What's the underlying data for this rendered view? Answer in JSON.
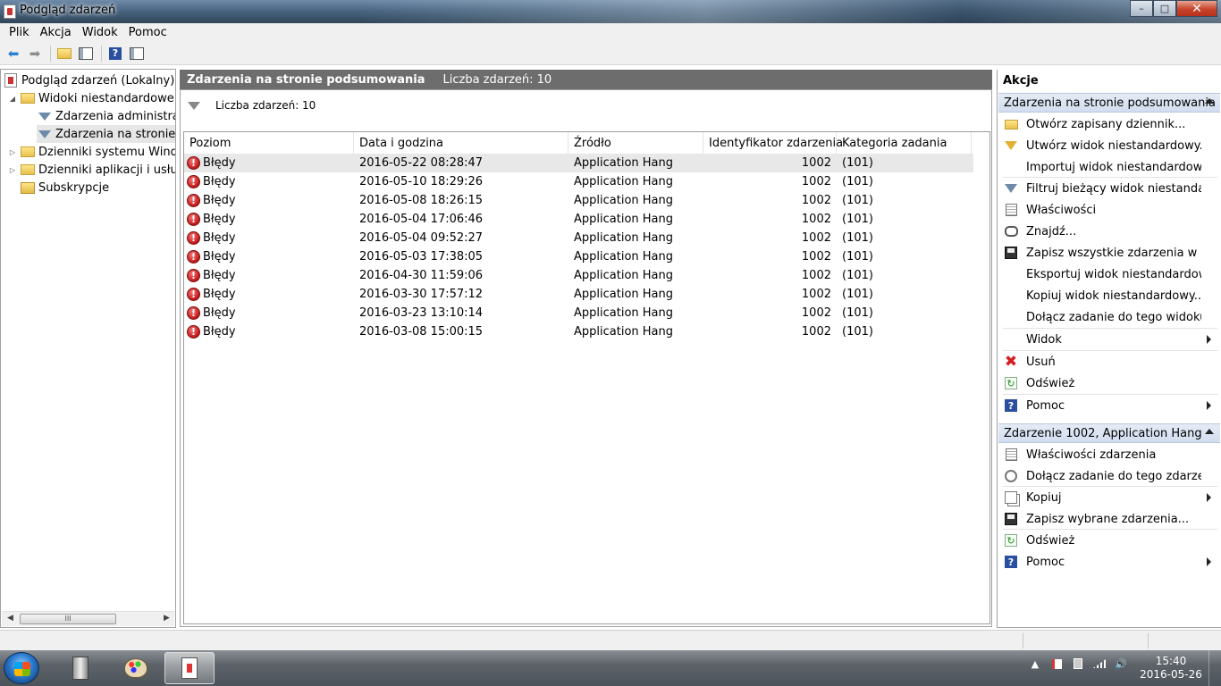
{
  "window": {
    "title": "Podgląd zdarzeń",
    "controls": {
      "minimize": "–",
      "maximize": "□",
      "close": "✕"
    }
  },
  "menu": [
    "Plik",
    "Akcja",
    "Widok",
    "Pomoc"
  ],
  "toolbar": {
    "icons": [
      "back-arrow-icon",
      "forward-arrow-icon",
      "up-folder-icon",
      "show-hide-tree-icon",
      "help-icon",
      "show-hide-action-pane-icon"
    ]
  },
  "tree": {
    "items": [
      {
        "label": "Podgląd zdarzeń (Lokalny)",
        "icon": "event-viewer-icon"
      },
      {
        "label": "Widoki niestandardowe",
        "icon": "folder-icon",
        "expander": "◢"
      },
      {
        "label": "Zdarzenia administracyjne",
        "icon": "filter-icon"
      },
      {
        "label": "Zdarzenia na stronie podsumowania",
        "icon": "filter-icon"
      },
      {
        "label": "Dzienniki systemu Windows",
        "icon": "folder-icon",
        "expander": "▷"
      },
      {
        "label": "Dzienniki aplikacji i usług",
        "icon": "folder-icon",
        "expander": "▷"
      },
      {
        "label": "Subskrypcje",
        "icon": "subscription-icon"
      }
    ],
    "scroll_left": "◀",
    "scroll_right": "▶",
    "scroll_grip": "III"
  },
  "main": {
    "header_title": "Zdarzenia na stronie podsumowania",
    "header_count": "Liczba zdarzeń: 10",
    "filter_text": "Liczba zdarzeń: 10",
    "columns": [
      "Poziom",
      "Data i godzina",
      "Źródło",
      "Identyfikator zdarzenia",
      "Kategoria zadania"
    ],
    "rows": [
      {
        "level": "Błędy",
        "datetime": "2016-05-22 08:28:47",
        "source": "Application Hang",
        "event_id": "1002",
        "category": "(101)"
      },
      {
        "level": "Błędy",
        "datetime": "2016-05-10 18:29:26",
        "source": "Application Hang",
        "event_id": "1002",
        "category": "(101)"
      },
      {
        "level": "Błędy",
        "datetime": "2016-05-08 18:26:15",
        "source": "Application Hang",
        "event_id": "1002",
        "category": "(101)"
      },
      {
        "level": "Błędy",
        "datetime": "2016-05-04 17:06:46",
        "source": "Application Hang",
        "event_id": "1002",
        "category": "(101)"
      },
      {
        "level": "Błędy",
        "datetime": "2016-05-04 09:52:27",
        "source": "Application Hang",
        "event_id": "1002",
        "category": "(101)"
      },
      {
        "level": "Błędy",
        "datetime": "2016-05-03 17:38:05",
        "source": "Application Hang",
        "event_id": "1002",
        "category": "(101)"
      },
      {
        "level": "Błędy",
        "datetime": "2016-04-30 11:59:06",
        "source": "Application Hang",
        "event_id": "1002",
        "category": "(101)"
      },
      {
        "level": "Błędy",
        "datetime": "2016-03-30 17:57:12",
        "source": "Application Hang",
        "event_id": "1002",
        "category": "(101)"
      },
      {
        "level": "Błędy",
        "datetime": "2016-03-23 13:10:14",
        "source": "Application Hang",
        "event_id": "1002",
        "category": "(101)"
      },
      {
        "level": "Błędy",
        "datetime": "2016-03-08 15:00:15",
        "source": "Application Hang",
        "event_id": "1002",
        "category": "(101)"
      }
    ],
    "error_glyph": "!"
  },
  "actions": {
    "title": "Akcje",
    "section1": {
      "title": "Zdarzenia na stronie podsumowania",
      "items": [
        {
          "label": "Otwórz zapisany dziennik...",
          "icon": "open-folder-icon"
        },
        {
          "label": "Utwórz widok niestandardowy...",
          "icon": "create-filter-icon"
        },
        {
          "label": "Importuj widok niestandardowy...",
          "icon": ""
        },
        {
          "label": "Filtruj bieżący widok niestandardowy...",
          "icon": "filter-icon"
        },
        {
          "label": "Właściwości",
          "icon": "properties-icon"
        },
        {
          "label": "Znajdź...",
          "icon": "binoculars-icon"
        },
        {
          "label": "Zapisz wszystkie zdarzenia w widoku niestandardowym jako...",
          "icon": "save-icon"
        },
        {
          "label": "Eksportuj widok niestandardowy...",
          "icon": ""
        },
        {
          "label": "Kopiuj widok niestandardowy...",
          "icon": ""
        },
        {
          "label": "Dołącz zadanie do tego widoku...",
          "icon": ""
        },
        {
          "label": "Widok",
          "icon": "",
          "submenu": true
        },
        {
          "label": "Usuń",
          "icon": "delete-icon"
        },
        {
          "label": "Odśwież",
          "icon": "refresh-icon"
        },
        {
          "label": "Pomoc",
          "icon": "help-icon",
          "submenu": true
        }
      ]
    },
    "section2": {
      "title": "Zdarzenie 1002, Application Hang",
      "items": [
        {
          "label": "Właściwości zdarzenia",
          "icon": "properties-icon"
        },
        {
          "label": "Dołącz zadanie do tego zdarzenia...",
          "icon": "task-icon"
        },
        {
          "label": "Kopiuj",
          "icon": "copy-icon",
          "submenu": true
        },
        {
          "label": "Zapisz wybrane zdarzenia...",
          "icon": "save-icon"
        },
        {
          "label": "Odśwież",
          "icon": "refresh-icon"
        },
        {
          "label": "Pomoc",
          "icon": "help-icon",
          "submenu": true
        }
      ]
    }
  },
  "taskbar": {
    "apps": [
      "server-manager-icon",
      "paint-icon",
      "event-viewer-icon"
    ],
    "tray_icons": [
      "show-hidden-icons-icon",
      "action-center-icon",
      "power-icon",
      "network-icon",
      "volume-icon"
    ],
    "tray_expand": "▲",
    "time": "15:40",
    "date": "2016-05-26"
  },
  "colors": {
    "error_red": "#c41616",
    "section_header": "#d2ddef",
    "panel_header": "#6d6d6d"
  }
}
